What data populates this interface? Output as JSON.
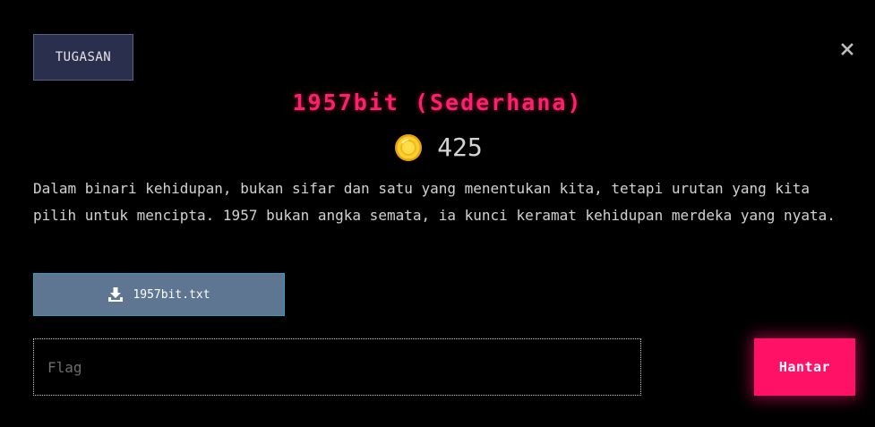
{
  "tab": {
    "label": "TUGASAN"
  },
  "close": {
    "icon": "close-icon"
  },
  "challenge": {
    "title": "1957bit (Sederhana)",
    "points": "425",
    "points_icon": "coin-icon",
    "description": "Dalam binari kehidupan, bukan sifar dan satu yang menentukan kita, tetapi urutan yang kita pilih untuk mencipta. 1957 bukan angka semata, ia kunci keramat kehidupan merdeka yang nyata."
  },
  "download": {
    "icon": "download-icon",
    "filename": "1957bit.txt"
  },
  "flag_form": {
    "placeholder": "Flag",
    "value": "",
    "submit_label": "Hantar"
  },
  "colors": {
    "accent": "#ff1f6d",
    "tab_bg": "#2b2f4e",
    "download_bg": "#5e7691",
    "submit_bg": "#ff1166",
    "background": "#000000"
  }
}
